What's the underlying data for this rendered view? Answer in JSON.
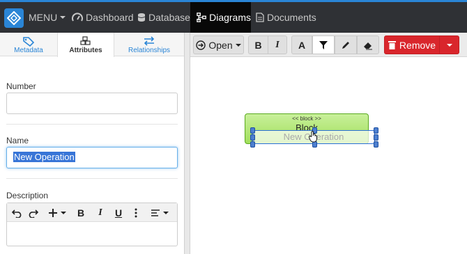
{
  "nav": {
    "menu_label": "MENU",
    "dashboard_label": "Dashboard",
    "database_label": "Database",
    "diagrams_label": "Diagrams",
    "documents_label": "Documents"
  },
  "tabs": [
    {
      "label": "Metadata"
    },
    {
      "label": "Attributes"
    },
    {
      "label": "Relationships"
    }
  ],
  "form": {
    "number_label": "Number",
    "number_value": "",
    "name_label": "Name",
    "name_value": "New Operation",
    "description_label": "Description"
  },
  "toolbar": {
    "open_label": "Open",
    "bold_label": "B",
    "italic_label": "I",
    "font_label": "A",
    "remove_label": "Remove"
  },
  "rte": {
    "bold": "B",
    "italic": "I",
    "underline": "U"
  },
  "diagram": {
    "stereotype": "<< block >>",
    "block_name": "Block",
    "operation_placeholder": "New Operation"
  },
  "colors": {
    "accent": "#2a85d6",
    "active_nav": "#080808",
    "remove": "#d9262c",
    "block_fill": "#a2df5c"
  }
}
